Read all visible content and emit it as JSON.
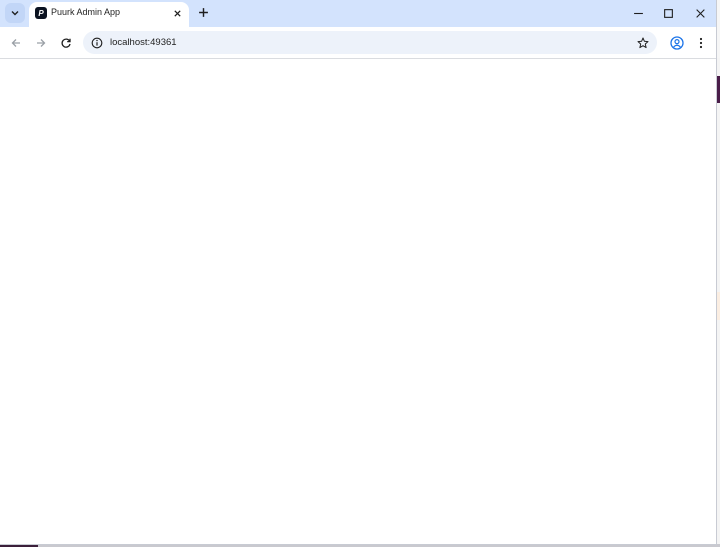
{
  "browser": {
    "tab": {
      "favicon_letter": "P",
      "title": "Puurk Admin App"
    },
    "address_bar": {
      "url": "localhost:49361"
    }
  },
  "icons": {
    "tab_search": "chevron-down-icon",
    "tab_close": "close-icon",
    "new_tab": "plus-icon",
    "minimize": "minimize-icon",
    "maximize": "maximize-icon",
    "window_close": "close-icon",
    "back": "arrow-left-icon",
    "forward": "arrow-right-icon",
    "reload": "reload-icon",
    "site_info": "info-icon",
    "bookmark": "star-icon",
    "profile": "profile-icon",
    "menu": "more-vertical-icon"
  },
  "colors": {
    "tabstrip": "#d3e3fd",
    "omnibox": "#edf2fa",
    "profile_accent": "#1a73e8"
  }
}
